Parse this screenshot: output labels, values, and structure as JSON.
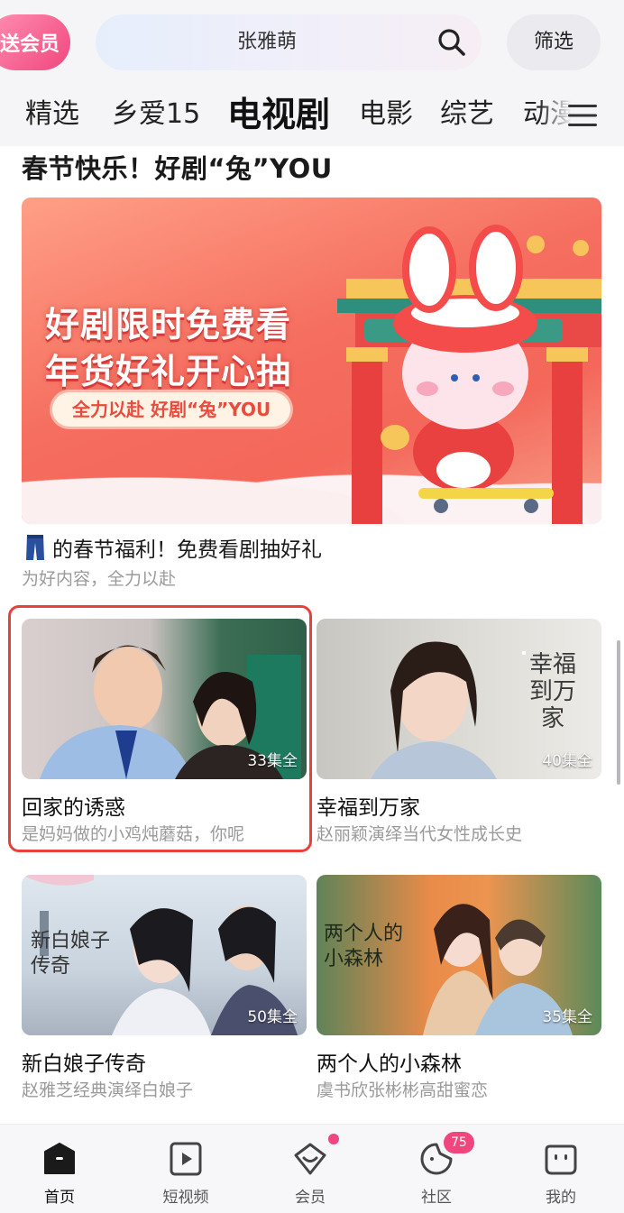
{
  "header": {
    "vip_label": "送会员",
    "search_text": "张雅萌",
    "filter_label": "筛选"
  },
  "tabs": [
    {
      "label": "精选"
    },
    {
      "label": "乡爱15"
    },
    {
      "label": "电视剧",
      "active": true
    },
    {
      "label": "电影"
    },
    {
      "label": "综艺"
    },
    {
      "label": "动漫"
    }
  ],
  "section": {
    "title": "春节快乐！好剧“兔”YOU"
  },
  "banner": {
    "line1": "好剧限时免费看",
    "line2": "年货好礼开心抽",
    "slogan": "全力以赴 好剧“兔”YOU"
  },
  "promo": {
    "title": "的春节福利！免费看剧抽好礼",
    "subtitle": "为好内容，全力以赴"
  },
  "cards": [
    {
      "title": "回家的诱惑",
      "subtitle": "是妈妈做的小鸡炖蘑菇，你呢",
      "episodes": "33集全"
    },
    {
      "title": "幸福到万家",
      "subtitle": "赵丽颖演绎当代女性成长史",
      "episodes": "40集全",
      "poster_text": "幸福到万家"
    },
    {
      "title": "新白娘子传奇",
      "subtitle": "赵雅芝经典演绎白娘子",
      "episodes": "50集全",
      "poster_text": "新白娘子传奇"
    },
    {
      "title": "两个人的小森林",
      "subtitle": "虞书欣张彬彬高甜蜜恋",
      "episodes": "35集全",
      "poster_text": "两个人的小森林"
    }
  ],
  "bottom_nav": [
    {
      "label": "首页",
      "active": true
    },
    {
      "label": "短视频"
    },
    {
      "label": "会员"
    },
    {
      "label": "社区",
      "badge": "75"
    },
    {
      "label": "我的"
    }
  ],
  "colors": {
    "accent_pink": "#f0457d",
    "highlight_red": "#e8413a",
    "banner_red": "#f4675a"
  }
}
